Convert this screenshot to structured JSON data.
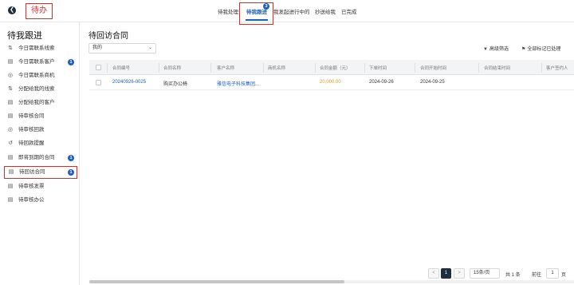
{
  "header": {
    "module_title": "待办",
    "tabs": [
      {
        "label": "待我处理"
      },
      {
        "label": "待我跟进",
        "badge": "3"
      },
      {
        "label": "我发起进行中的"
      },
      {
        "label": "抄送给我"
      },
      {
        "label": "已完成"
      }
    ]
  },
  "sidebar": {
    "title": "待我跟进",
    "items": [
      {
        "label": "今日需联系线索",
        "icon": "clue-icon"
      },
      {
        "label": "今日需联系客户",
        "icon": "customer-icon",
        "badge": "1"
      },
      {
        "label": "今日需联系商机",
        "icon": "opportunity-icon"
      },
      {
        "label": "分配给我的线索",
        "icon": "assign-clue-icon"
      },
      {
        "label": "分配给我的客户",
        "icon": "assign-customer-icon"
      },
      {
        "label": "待审核合同",
        "icon": "contract-icon"
      },
      {
        "label": "待审核回款",
        "icon": "payment-icon"
      },
      {
        "label": "待回款提醒",
        "icon": "reminder-icon"
      },
      {
        "label": "即将到期的合同",
        "icon": "expiring-contract-icon",
        "badge": "1"
      },
      {
        "label": "待回访合同",
        "icon": "revisit-contract-icon",
        "badge": "1"
      },
      {
        "label": "待审核发票",
        "icon": "invoice-icon"
      },
      {
        "label": "待审核办公",
        "icon": "office-icon"
      }
    ]
  },
  "main": {
    "title": "待回访合同",
    "scope_select": "我的",
    "actions": {
      "filter": "高级筛选",
      "mark_all": "全部标记已处理"
    },
    "columns": [
      "合同编号",
      "合同名称",
      "客户名称",
      "商机名称",
      "合同金额（元）",
      "下单时间",
      "合同开始时间",
      "合同结束时间",
      "客户签约人"
    ],
    "rows": [
      {
        "contract_no": "20240926-0025",
        "contract_name": "购买办公椅",
        "customer_name": "雅信电子科技集团...",
        "opportunity_name": "",
        "amount": "20,000.00",
        "order_date": "2024-09-26",
        "start_date": "2024-09-25",
        "end_date": "",
        "signer": ""
      }
    ],
    "pagination": {
      "prev": "<",
      "current_page": "1",
      "next": ">",
      "page_size": "15条/页",
      "total": "共 1 条",
      "goto_label": "前往",
      "goto_value": "1",
      "page_suffix": "页"
    }
  },
  "colors": {
    "accent": "#1f5fbf",
    "highlight_border": "#d0312d",
    "amount": "#e6961e",
    "dark": "#1f2d3d"
  }
}
